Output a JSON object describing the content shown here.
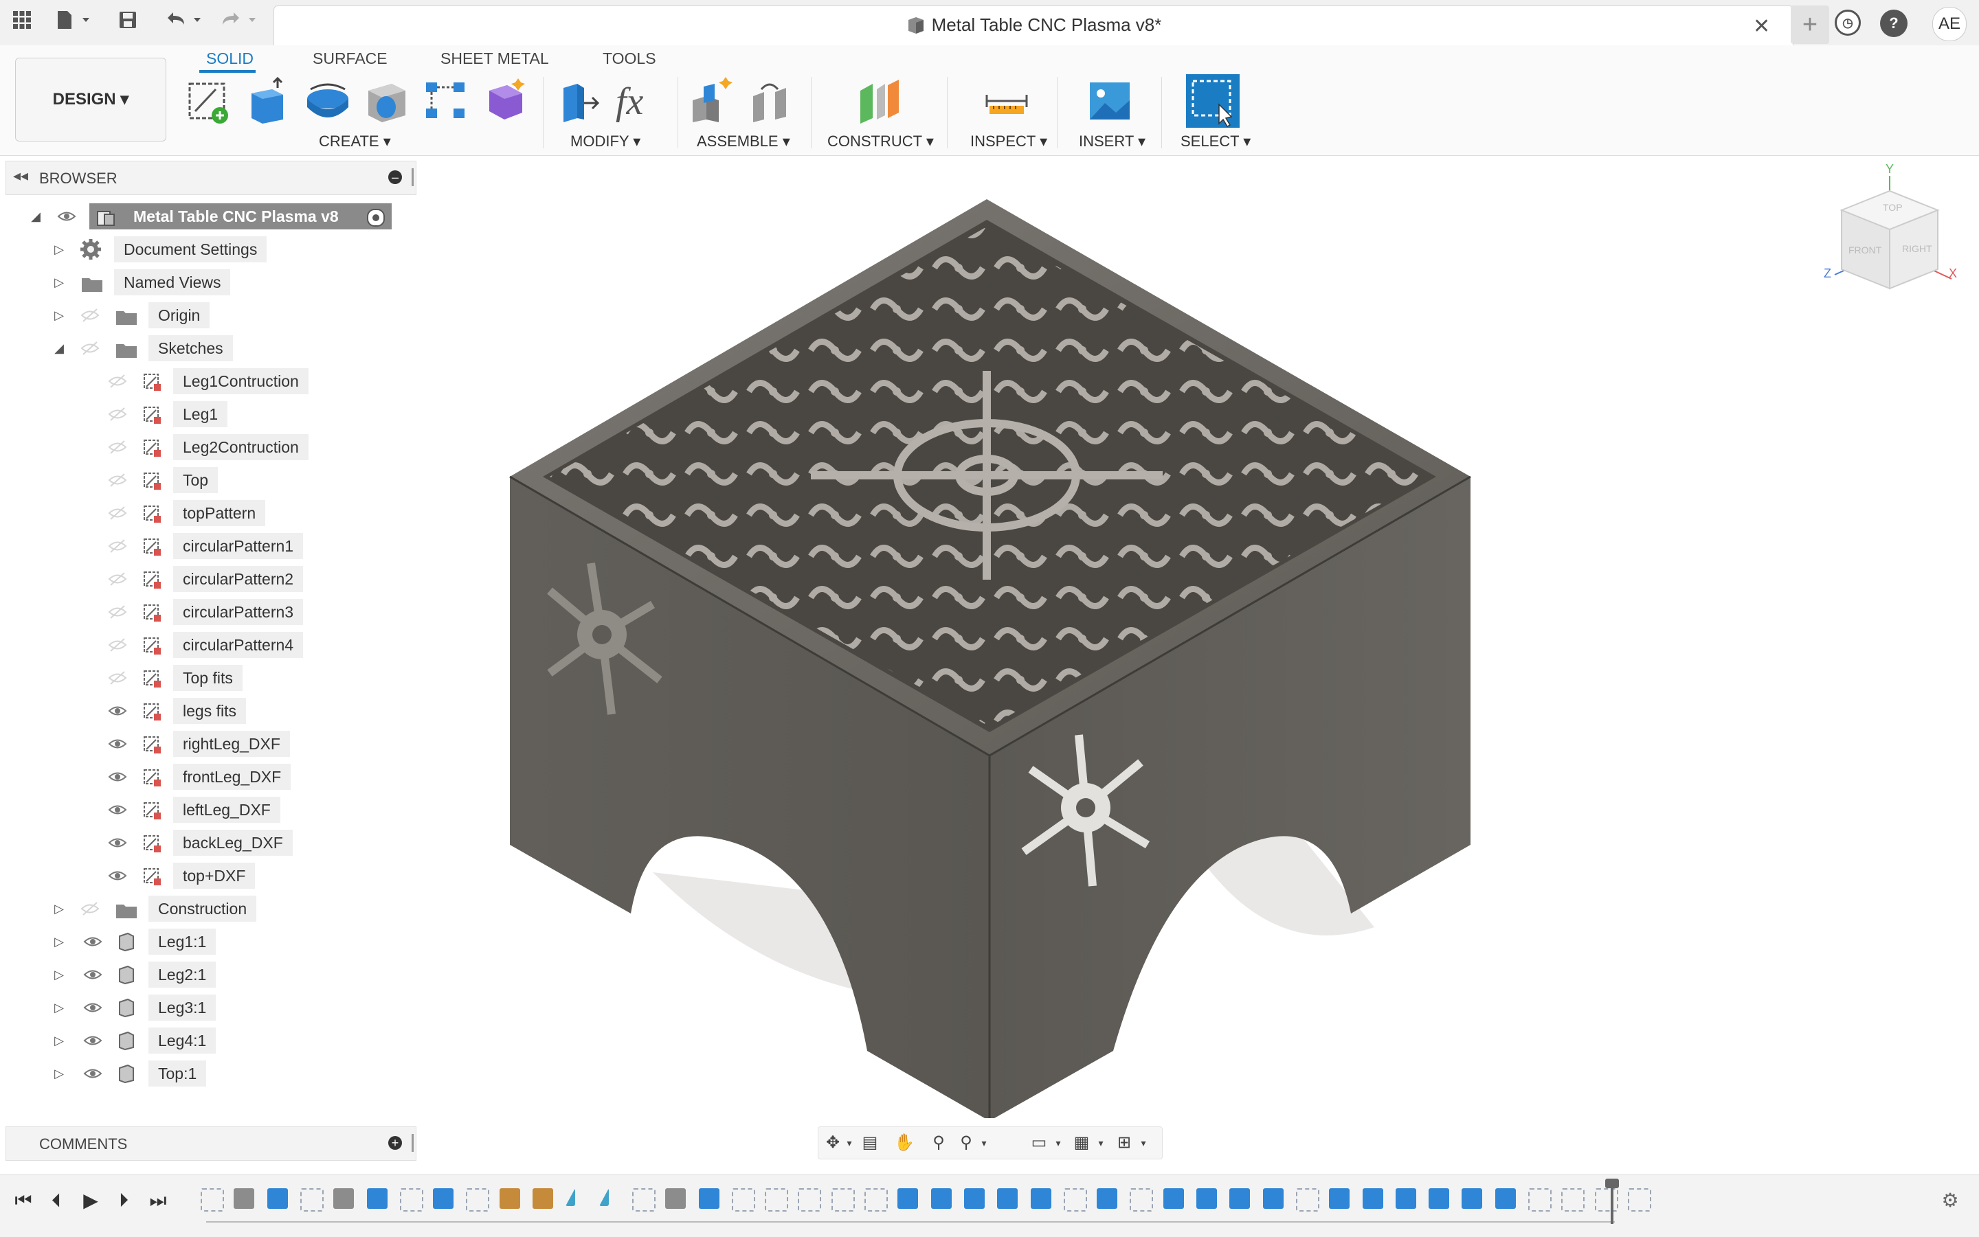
{
  "window": {
    "title": "Metal Table CNC Plasma v8*",
    "user_initials": "AE"
  },
  "workspace": {
    "label": "DESIGN"
  },
  "tabs": [
    {
      "label": "SOLID",
      "active": true
    },
    {
      "label": "SURFACE",
      "active": false
    },
    {
      "label": "SHEET METAL",
      "active": false
    },
    {
      "label": "TOOLS",
      "active": false
    }
  ],
  "groups": {
    "create": "CREATE",
    "modify": "MODIFY",
    "assemble": "ASSEMBLE",
    "construct": "CONSTRUCT",
    "inspect": "INSPECT",
    "insert": "INSERT",
    "select": "SELECT"
  },
  "browser": {
    "label": "BROWSER",
    "root": "Metal Table CNC Plasma v8",
    "items": {
      "document_settings": "Document Settings",
      "named_views": "Named Views",
      "origin": "Origin",
      "sketches": "Sketches",
      "construction": "Construction"
    },
    "sketches": [
      {
        "label": "Leg1Contruction",
        "visible": false
      },
      {
        "label": "Leg1",
        "visible": false
      },
      {
        "label": "Leg2Contruction",
        "visible": false
      },
      {
        "label": "Top",
        "visible": false
      },
      {
        "label": "topPattern",
        "visible": false
      },
      {
        "label": "circularPattern1",
        "visible": false
      },
      {
        "label": "circularPattern2",
        "visible": false
      },
      {
        "label": "circularPattern3",
        "visible": false
      },
      {
        "label": "circularPattern4",
        "visible": false
      },
      {
        "label": "Top fits",
        "visible": false
      },
      {
        "label": "legs fits",
        "visible": true
      },
      {
        "label": "rightLeg_DXF",
        "visible": true
      },
      {
        "label": "frontLeg_DXF",
        "visible": true
      },
      {
        "label": "leftLeg_DXF",
        "visible": true
      },
      {
        "label": "backLeg_DXF",
        "visible": true
      },
      {
        "label": "top+DXF",
        "visible": true
      }
    ],
    "bodies": [
      "Leg1:1",
      "Leg2:1",
      "Leg3:1",
      "Leg4:1",
      "Top:1"
    ]
  },
  "comments": {
    "label": "COMMENTS"
  },
  "viewcube": {
    "top": "TOP",
    "front": "FRONT",
    "right": "RIGHT",
    "x": "X",
    "y": "Y",
    "z": "Z"
  },
  "colors": {
    "accent": "#1a7dc4",
    "metal": "#5b5853",
    "panel": "#f3f3f3"
  }
}
